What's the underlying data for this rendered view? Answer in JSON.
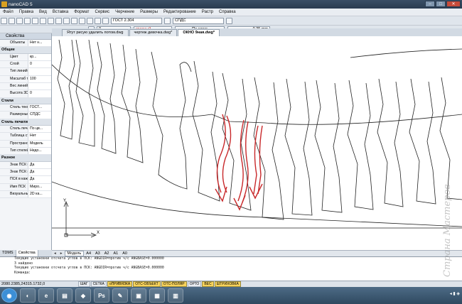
{
  "window": {
    "title": "nanoCAD 5"
  },
  "menu": [
    "Файл",
    "Правка",
    "Вид",
    "Вставка",
    "Формат",
    "Сервис",
    "Черчение",
    "Размеры",
    "Редактирование",
    "Растр",
    "Справка"
  ],
  "toolbar": {
    "style_combo": "ГОСТ 2.304",
    "dim_style_combo": "СПДС",
    "layer_combo": "0",
    "color_combo": "красный",
    "linetype_combo": "По слою",
    "lineweight_combo": "0.35 mm"
  },
  "properties_panel": {
    "title": "Свойства",
    "objects_label": "Объекты",
    "objects_value": "Нет н...",
    "sections": [
      {
        "name": "Общие",
        "rows": [
          {
            "k": "Цвет",
            "v": "кр..."
          },
          {
            "k": "Слой",
            "v": "0"
          },
          {
            "k": "Тип линий",
            "v": ""
          },
          {
            "k": "Масштаб ти...",
            "v": "100"
          },
          {
            "k": "Вес линий",
            "v": ""
          },
          {
            "k": "Высота 3D",
            "v": "0"
          }
        ]
      },
      {
        "name": "Стили",
        "rows": [
          {
            "k": "Стиль текста",
            "v": "ГОСТ..."
          },
          {
            "k": "Размерный...",
            "v": "СПДС"
          }
        ]
      },
      {
        "name": "Стиль печати",
        "rows": [
          {
            "k": "Стиль печати",
            "v": "По цв..."
          },
          {
            "k": "Таблица ст...",
            "v": "Нет"
          },
          {
            "k": "Пространс...",
            "v": "Модель"
          },
          {
            "k": "Тип стилей...",
            "v": "Недо..."
          }
        ]
      },
      {
        "name": "Разное",
        "rows": [
          {
            "k": "Знак ПСК в...",
            "v": "Да"
          },
          {
            "k": "Знак ПСК в...",
            "v": "Да"
          },
          {
            "k": "ПСК в каж...",
            "v": "Да"
          },
          {
            "k": "Имя ПСК",
            "v": "Миро..."
          },
          {
            "k": "Визуальны...",
            "v": "2D ка..."
          }
        ]
      }
    ],
    "tabs": [
      "TDMS",
      "Свойства"
    ]
  },
  "documents": [
    {
      "name": "Ятут рисую удалить потом.dwg",
      "active": false
    },
    {
      "name": "чертеж девочка.dwg*",
      "active": false
    },
    {
      "name": "ОКНО 9ная.dwg*",
      "active": true
    }
  ],
  "layout_tabs": [
    "Модель",
    "A4",
    "A3",
    "A2",
    "A1",
    "A0"
  ],
  "ucs": {
    "x": "X",
    "y": "Y"
  },
  "command_lines": [
    "Текущие установки отсчета углов в ПСК:  ANGDIR=против ч/с   ANGBASE=0.000000",
    "3 найдено",
    "Текущие установки отсчета углов в ПСК:  ANGDIR=против ч/с   ANGBASE=0.000000",
    "Команда:"
  ],
  "status": {
    "coords": "2080.2385,24315.1732,0",
    "buttons": [
      {
        "label": "ШАГ",
        "on": false
      },
      {
        "label": "СЕТКА",
        "on": false
      },
      {
        "label": "оПРИВЯЗКА",
        "on": true
      },
      {
        "label": "ОТС-ОБЪЕКТ",
        "on": true
      },
      {
        "label": "ОТС-ПОЛЯР",
        "on": true
      },
      {
        "label": "ОРТО",
        "on": false
      },
      {
        "label": "ВЕС",
        "on": true
      },
      {
        "label": "ШТРИХОВКА",
        "on": true
      }
    ]
  },
  "taskbar": {
    "apps": [
      "start",
      "chrome",
      "explorer",
      "folder",
      "nanocad",
      "photoshop",
      "paint",
      "app",
      "app",
      "app"
    ]
  },
  "watermark": "Страна Мастеров",
  "colors": {
    "accent_red": "#c8282a",
    "status_on": "#f7d35c"
  }
}
